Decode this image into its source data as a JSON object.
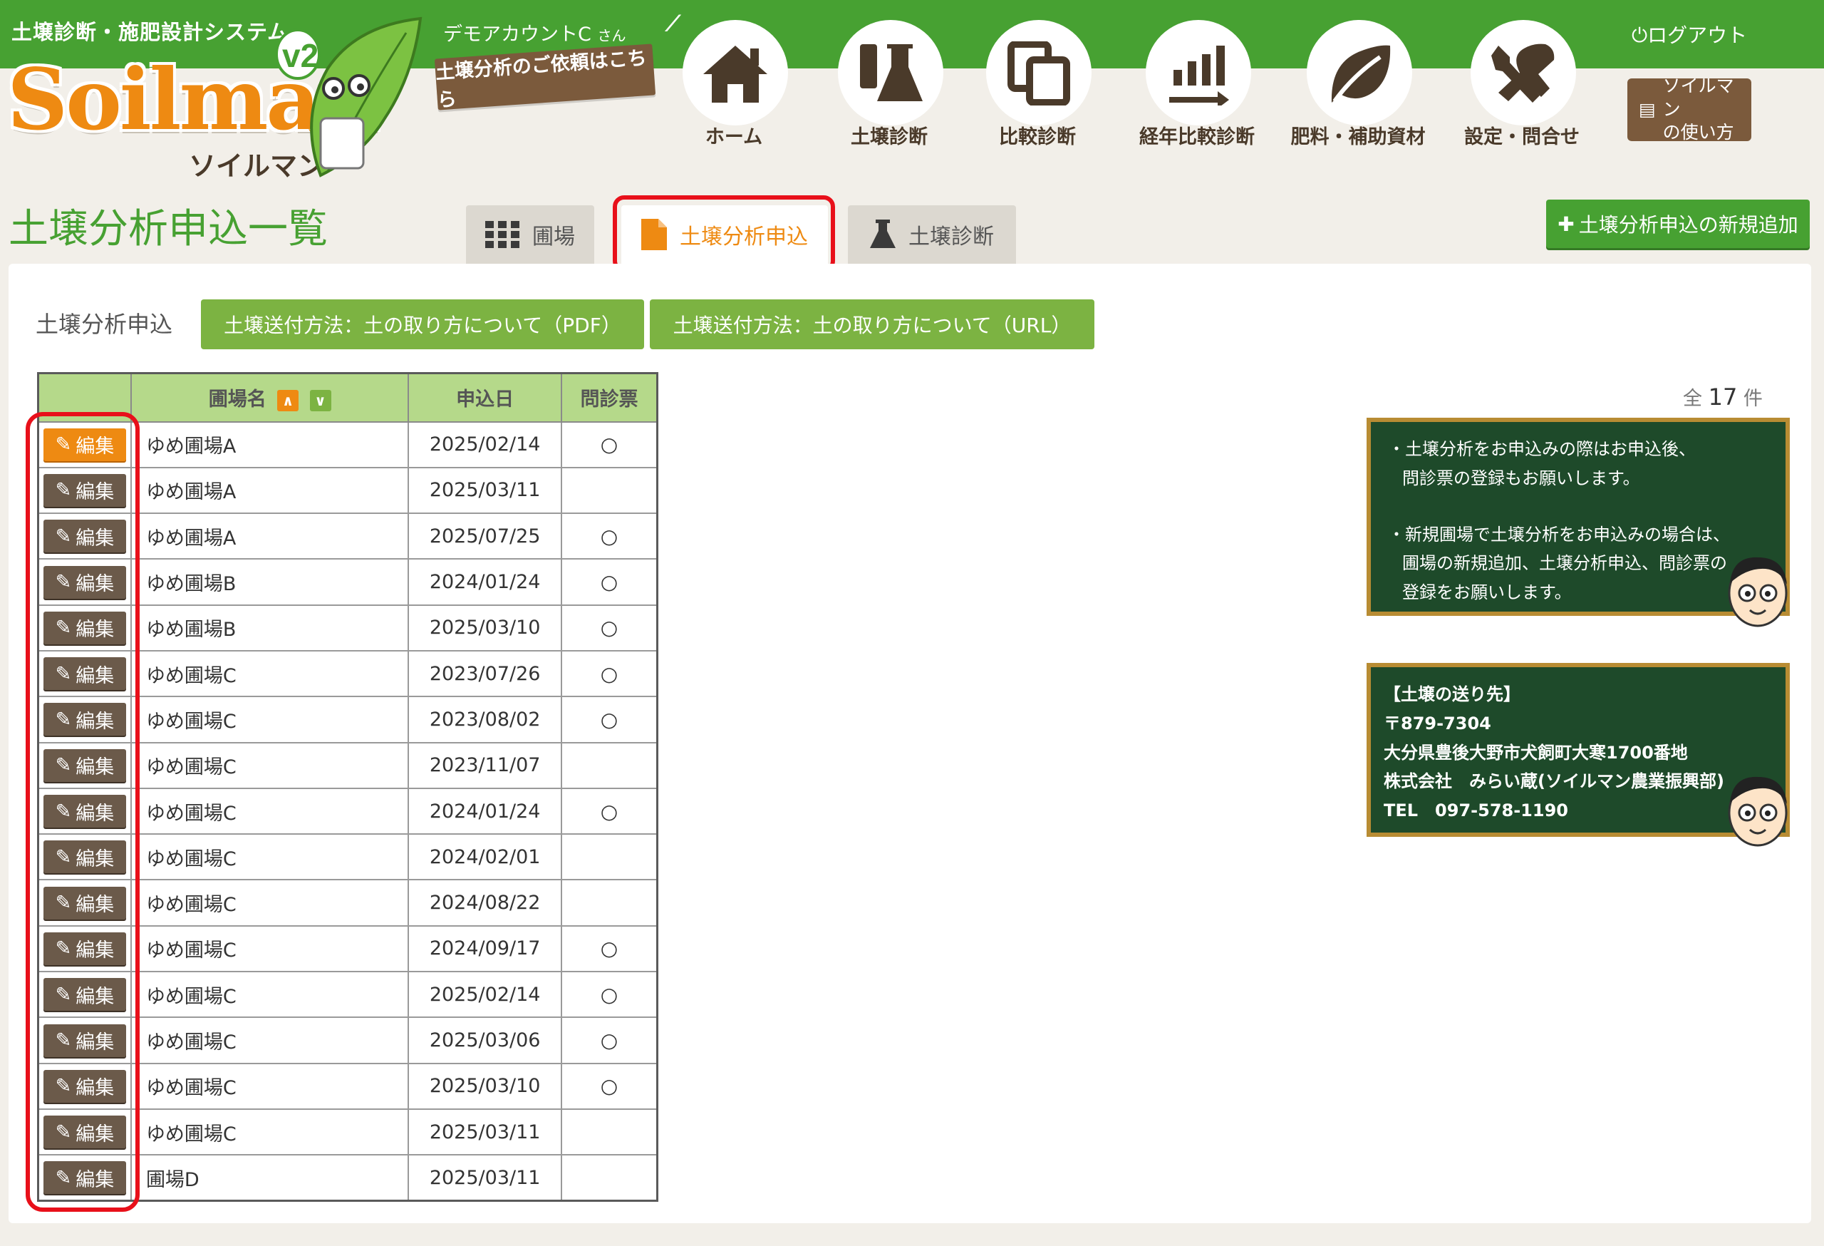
{
  "header": {
    "tagline": "土壌診断・施肥設計システム",
    "logo_text": "Soilman",
    "logo_badge": "v2",
    "logo_reg": "®",
    "logo_kana": "ソイルマン",
    "user_name": "デモアカウントC",
    "user_suffix": "さん",
    "request_banner": "土壌分析のご依頼はこちら",
    "logout": "ログアウト",
    "howto_line1": "ソイルマン",
    "howto_line2": "の使い方"
  },
  "nav": [
    {
      "label": "ホーム",
      "icon": "home-icon"
    },
    {
      "label": "土壌診断",
      "icon": "flask-icon"
    },
    {
      "label": "比較診断",
      "icon": "copy-icon"
    },
    {
      "label": "経年比較診断",
      "icon": "trend-chart-icon"
    },
    {
      "label": "肥料・補助資材",
      "icon": "leaf-icon"
    },
    {
      "label": "設定・問合せ",
      "icon": "tools-icon"
    }
  ],
  "page": {
    "title": "土壌分析申込一覧",
    "tabs": [
      {
        "label": "圃場",
        "icon": "grid-icon",
        "active": false
      },
      {
        "label": "土壌分析申込",
        "icon": "document-icon",
        "active": true
      },
      {
        "label": "土壌診断",
        "icon": "flask-icon",
        "active": false
      }
    ],
    "add_button": "土壌分析申込の新規追加"
  },
  "section": {
    "label": "土壌分析申込",
    "guide_pdf": "土壌送付方法：土の取り方について（PDF）",
    "guide_url": "土壌送付方法：土の取り方について（URL）"
  },
  "table": {
    "headers": {
      "name": "圃場名",
      "date": "申込日",
      "questionnaire": "問診票"
    },
    "edit_label": "編集",
    "rows": [
      {
        "name": "ゆめ圃場A",
        "date": "2025/02/14",
        "q": "○"
      },
      {
        "name": "ゆめ圃場A",
        "date": "2025/03/11",
        "q": ""
      },
      {
        "name": "ゆめ圃場A",
        "date": "2025/07/25",
        "q": "○"
      },
      {
        "name": "ゆめ圃場B",
        "date": "2024/01/24",
        "q": "○"
      },
      {
        "name": "ゆめ圃場B",
        "date": "2025/03/10",
        "q": "○"
      },
      {
        "name": "ゆめ圃場C",
        "date": "2023/07/26",
        "q": "○"
      },
      {
        "name": "ゆめ圃場C",
        "date": "2023/08/02",
        "q": "○"
      },
      {
        "name": "ゆめ圃場C",
        "date": "2023/11/07",
        "q": ""
      },
      {
        "name": "ゆめ圃場C",
        "date": "2024/01/24",
        "q": "○"
      },
      {
        "name": "ゆめ圃場C",
        "date": "2024/02/01",
        "q": ""
      },
      {
        "name": "ゆめ圃場C",
        "date": "2024/08/22",
        "q": ""
      },
      {
        "name": "ゆめ圃場C",
        "date": "2024/09/17",
        "q": "○"
      },
      {
        "name": "ゆめ圃場C",
        "date": "2025/02/14",
        "q": "○"
      },
      {
        "name": "ゆめ圃場C",
        "date": "2025/03/06",
        "q": "○"
      },
      {
        "name": "ゆめ圃場C",
        "date": "2025/03/10",
        "q": "○"
      },
      {
        "name": "ゆめ圃場C",
        "date": "2025/03/11",
        "q": ""
      },
      {
        "name": "圃場D",
        "date": "2025/03/11",
        "q": ""
      }
    ]
  },
  "total": {
    "prefix": "全",
    "count": "17",
    "suffix": "件"
  },
  "notice_board": {
    "line1": "・土壌分析をお申込みの際はお申込後、",
    "line2": "問診票の登録もお願いします。",
    "line3": "・新規圃場で土壌分析をお申込みの場合は、",
    "line4": "圃場の新規追加、土壌分析申込、問診票の",
    "line5": "登録をお願いします。"
  },
  "address_board": {
    "title": "【土壌の送り先】",
    "zip": "〒879-7304",
    "address": "大分県豊後大野市犬飼町大寒1700番地",
    "company": "株式会社　みらい蔵(ソイルマン農業振興部)",
    "tel": "TEL　097-578-1190"
  },
  "colors": {
    "brand_green": "#47a132",
    "accent_orange": "#ee8a12",
    "brown": "#7b5a3c",
    "highlight_red": "#e8101a",
    "board_green": "#1e4a2a"
  }
}
